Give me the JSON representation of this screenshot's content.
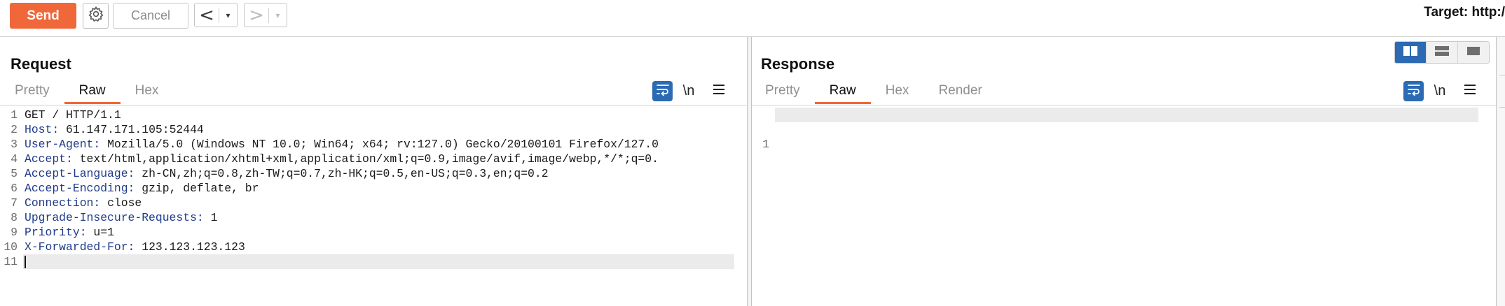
{
  "toolbar": {
    "send_label": "Send",
    "cancel_label": "Cancel",
    "back_arrow": "<",
    "forward_arrow": ">",
    "dropdown_glyph": "▾",
    "target_label": "Target: http:/"
  },
  "request": {
    "title": "Request",
    "tabs": [
      {
        "label": "Pretty",
        "active": false
      },
      {
        "label": "Raw",
        "active": true
      },
      {
        "label": "Hex",
        "active": false
      }
    ],
    "newline_toggle": "\\n",
    "lines": [
      {
        "num": "1",
        "name": "",
        "sep": "",
        "value": "GET / HTTP/1.1"
      },
      {
        "num": "2",
        "name": "Host",
        "sep": ": ",
        "value": "61.147.171.105:52444"
      },
      {
        "num": "3",
        "name": "User-Agent",
        "sep": ": ",
        "value": "Mozilla/5.0 (Windows NT 10.0; Win64; x64; rv:127.0) Gecko/20100101 Firefox/127.0"
      },
      {
        "num": "4",
        "name": "Accept",
        "sep": ": ",
        "value": "text/html,application/xhtml+xml,application/xml;q=0.9,image/avif,image/webp,*/*;q=0."
      },
      {
        "num": "5",
        "name": "Accept-Language",
        "sep": ": ",
        "value": "zh-CN,zh;q=0.8,zh-TW;q=0.7,zh-HK;q=0.5,en-US;q=0.3,en;q=0.2"
      },
      {
        "num": "6",
        "name": "Accept-Encoding",
        "sep": ": ",
        "value": "gzip, deflate, br"
      },
      {
        "num": "7",
        "name": "Connection",
        "sep": ": ",
        "value": "close"
      },
      {
        "num": "8",
        "name": "Upgrade-Insecure-Requests",
        "sep": ": ",
        "value": "1"
      },
      {
        "num": "9",
        "name": "Priority",
        "sep": ": ",
        "value": "u=1"
      },
      {
        "num": "10",
        "name": "X-Forwarded-For",
        "sep": ": ",
        "value": "123.123.123.123"
      },
      {
        "num": "11",
        "name": "",
        "sep": "",
        "value": ""
      }
    ]
  },
  "response": {
    "title": "Response",
    "tabs": [
      {
        "label": "Pretty",
        "active": false
      },
      {
        "label": "Raw",
        "active": true
      },
      {
        "label": "Hex",
        "active": false
      },
      {
        "label": "Render",
        "active": false
      }
    ],
    "newline_toggle": "\\n",
    "lines": [
      {
        "num": "1",
        "value": ""
      }
    ]
  },
  "colors": {
    "accent": "#f0673a",
    "toggle_blue": "#2c6ab3",
    "header_name": "#1e3a8a"
  }
}
